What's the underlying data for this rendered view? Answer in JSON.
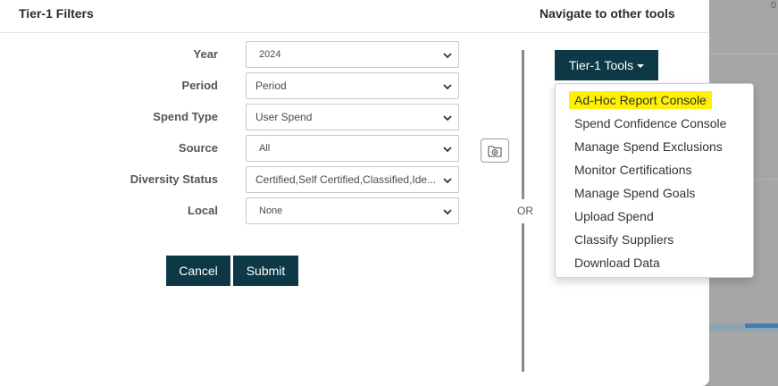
{
  "modal": {
    "filters_title": "Tier-1 Filters",
    "navigate_title": "Navigate to other tools"
  },
  "filters": [
    {
      "label": "Year",
      "value": "2024"
    },
    {
      "label": "Period",
      "value": "Period"
    },
    {
      "label": "Spend Type",
      "value": "User Spend"
    },
    {
      "label": "Source",
      "value": "All"
    },
    {
      "label": "Diversity Status",
      "value": "Certified,Self Certified,Classified,Ide..."
    },
    {
      "label": "Local",
      "value": "None"
    }
  ],
  "actions": {
    "cancel_label": "Cancel",
    "submit_label": "Submit"
  },
  "or_label": "OR",
  "tools": {
    "button_label": "Tier-1 Tools",
    "items": [
      "Ad-Hoc Report Console",
      "Spend Confidence Console",
      "Manage Spend Exclusions",
      "Monitor Certifications",
      "Manage Spend Goals",
      "Upload Spend",
      "Classify Suppliers",
      "Download Data"
    ],
    "highlighted_index": 0,
    "highlight_color": "#fff200"
  },
  "background": {
    "corner_text": "0"
  },
  "colors": {
    "primary_button": "#0d3947",
    "divider": "#888888"
  }
}
